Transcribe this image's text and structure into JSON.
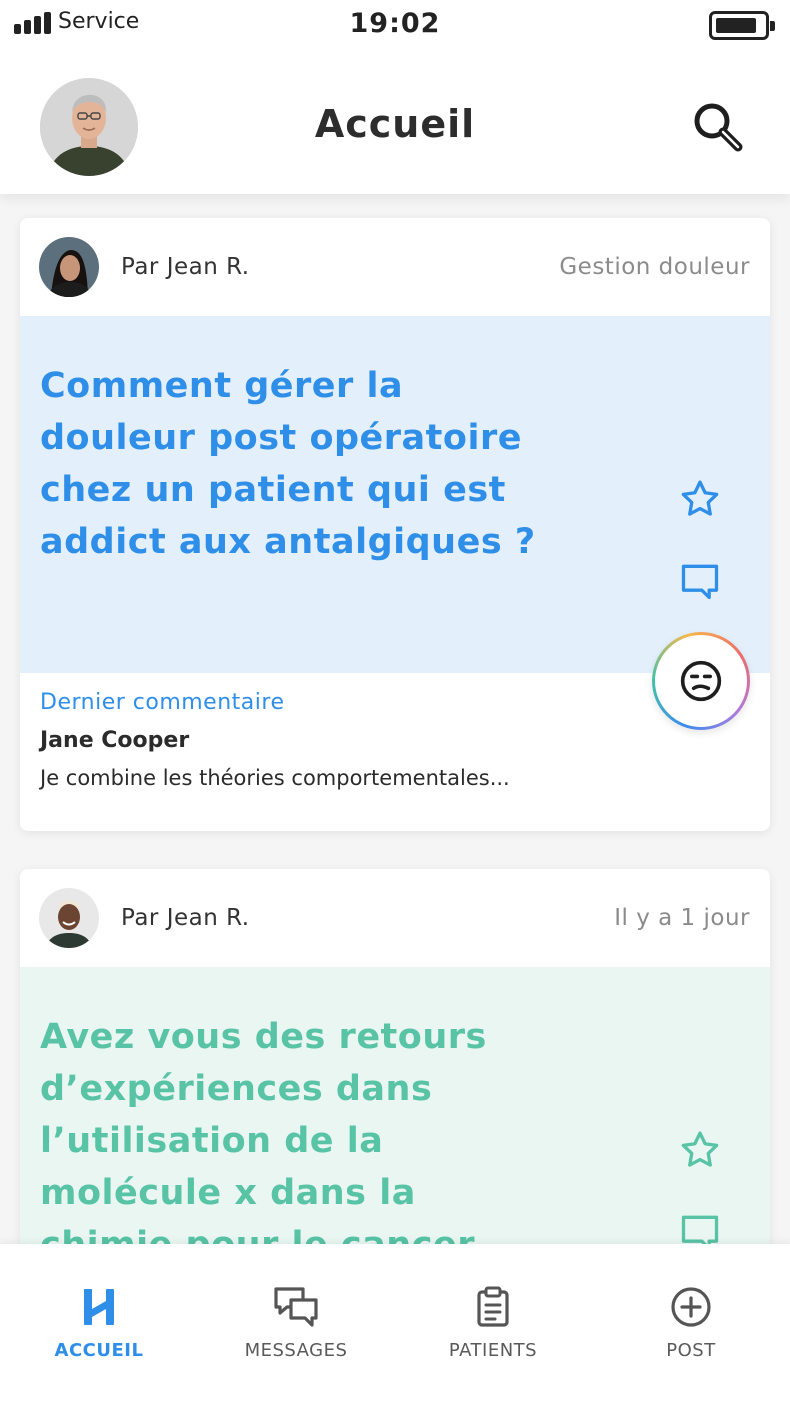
{
  "status_bar": {
    "carrier": "Service",
    "time": "19:02"
  },
  "header": {
    "title": "Accueil"
  },
  "posts": [
    {
      "author": "Par Jean R.",
      "meta": "Gestion  douleur",
      "question": "Comment gérer  la douleur post opératoire chez un patient qui est addict aux antalgiques ?",
      "last_comment_heading": "Dernier commentaire",
      "last_comment_author": "Jane Cooper",
      "last_comment_text": "Je combine les théories comportementales..."
    },
    {
      "author": "Par Jean R.",
      "meta": "Il y a 1 jour",
      "question": "Avez vous des retours d’expériences dans l’utilisation de la molécule x dans la chimie pour le cancer"
    }
  ],
  "bottom_nav": [
    {
      "label": "ACCUEIL",
      "icon": "home-logo-icon",
      "active": true
    },
    {
      "label": "MESSAGES",
      "icon": "chat-bubbles-icon",
      "active": false
    },
    {
      "label": "PATIENTS",
      "icon": "clipboard-icon",
      "active": false
    },
    {
      "label": "POST",
      "icon": "plus-circle-icon",
      "active": false
    }
  ],
  "colors": {
    "blue_accent": "#2f8fe8",
    "green_accent": "#58c3a5",
    "card1_bg": "#e3f0fc",
    "card2_bg": "#eaf6f2"
  }
}
